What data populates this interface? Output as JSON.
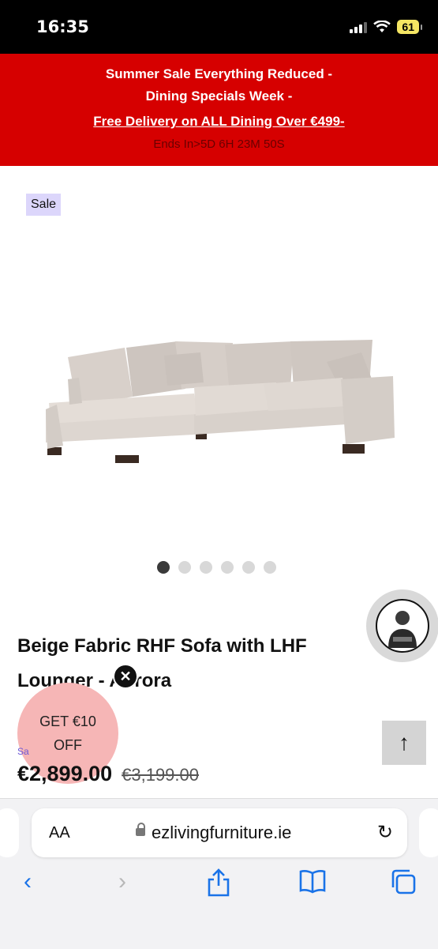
{
  "status_bar": {
    "time": "16:35",
    "battery": "61"
  },
  "promo": {
    "line1": "Summer Sale Everything Reduced -",
    "line2": "Dining Specials Week -",
    "line3": "Free Delivery on ALL Dining Over €499-",
    "countdown": "Ends In>5D 6H 23M 50S",
    "background_color": "#d60000"
  },
  "product": {
    "sale_tag": "Sale",
    "title": "Beige Fabric RHF Sofa with LHF Lounger - Aurora",
    "sale_label": "Sa",
    "price": "€2,899.00",
    "old_price": "€3,199.00",
    "carousel": {
      "count": 6,
      "active": 0
    }
  },
  "offer_bubble": {
    "line1": "GET €10",
    "line2": "OFF",
    "close": "✕"
  },
  "scroll_top": "↑",
  "browser": {
    "text_size": "AA",
    "url": "ezlivingfurniture.ie",
    "reload": "↻",
    "back": "‹",
    "forward": "›",
    "share": "share-icon",
    "bookmarks": "book-icon",
    "tabs": "tabs-icon"
  }
}
